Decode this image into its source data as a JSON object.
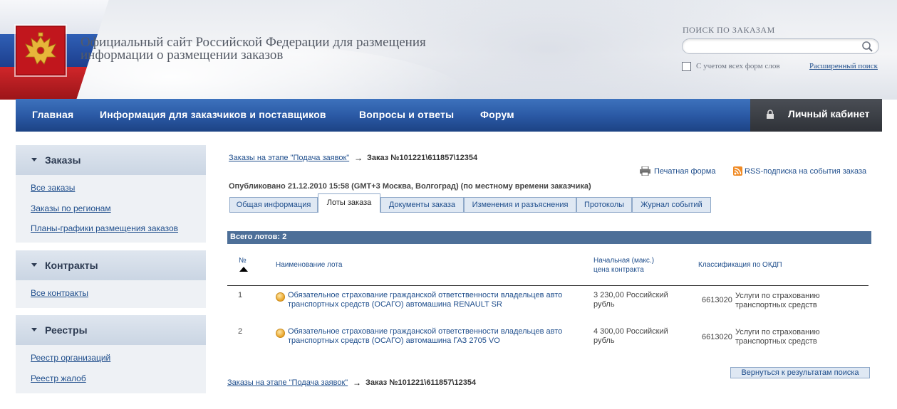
{
  "header": {
    "site_title_line1": "Официальный сайт Российской Федерации для размещения",
    "site_title_line2": "информации о размещении заказов",
    "search_label": "ПОИСК ПО ЗАКАЗАМ",
    "search_value": "",
    "checkbox_label": "С учетом всех форм слов",
    "advanced_search": "Расширенный поиск"
  },
  "nav": {
    "items": [
      "Главная",
      "Информация для заказчиков и поставщиков",
      "Вопросы и ответы",
      "Форум"
    ],
    "cabinet": "Личный кабинет"
  },
  "sidebar": {
    "orders": {
      "title": "Заказы",
      "links": [
        "Все заказы",
        "Заказы по регионам",
        "Планы-графики размещения заказов"
      ]
    },
    "contracts": {
      "title": "Контракты",
      "links": [
        "Все контракты"
      ]
    },
    "registries": {
      "title": "Реестры",
      "links": [
        "Реестр организаций",
        "Реестр жалоб"
      ]
    }
  },
  "breadcrumb": {
    "parent": "Заказы на этапе \"Подача заявок\"",
    "arrow": "→",
    "current": "Заказ №101221\\611857\\12354"
  },
  "actions": {
    "print": "Печатная форма",
    "rss": "RSS-подписка на события заказа"
  },
  "published": "Опубликовано 21.12.2010 15:58 (GMT+3 Москва, Волгоград) (по местному времени заказчика)",
  "tabs": [
    "Общая информация",
    "Лоты заказа",
    "Документы заказа",
    "Изменения и разъяснения",
    "Протоколы",
    "Журнал событий"
  ],
  "active_tab": "Лоты заказа",
  "lots": {
    "total": "Всего лотов: 2",
    "headers": {
      "num": "№",
      "name": "Наименование лота",
      "price_line1": "Начальная (макс.)",
      "price_line2": "цена контракта",
      "okdp": "Классификация по ОКДП"
    },
    "rows": [
      {
        "num": "1",
        "name_line1": "Обязательное страхование гражданской ответственности владельцев авто",
        "name_line2": "транспортных средств (ОСАГО) автомашина RENAULT SR",
        "price_line1": "3 230,00 Российский",
        "price_line2": "рубль",
        "okdp_code": "6613020",
        "okdp_line1": "Услуги по страхованию",
        "okdp_line2": "транспортных средств"
      },
      {
        "num": "2",
        "name_line1": "Обязательное страхование гражданской ответственности владельцев авто",
        "name_line2": "транспортных средств (ОСАГО) автомашина ГАЗ 2705 VO",
        "price_line1": "4 300,00 Российский",
        "price_line2": "рубль",
        "okdp_code": "6613020",
        "okdp_line1": "Услуги по страхованию",
        "okdp_line2": "транспортных средств"
      }
    ]
  },
  "back_button": "Вернуться к результатам поиска",
  "colors": {
    "nav_blue": "#2b5aa6",
    "link": "#1f4e8c",
    "lots_bar": "#4d6f98",
    "emblem_red": "#c1161d"
  }
}
